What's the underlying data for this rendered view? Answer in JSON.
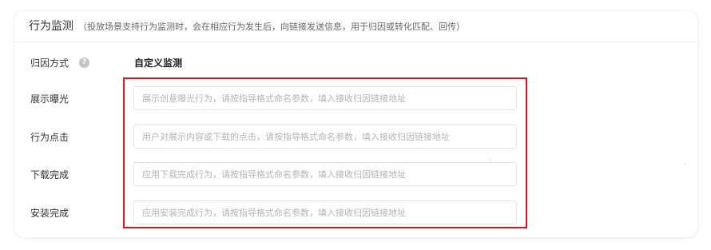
{
  "section": {
    "title": "行为监测",
    "description": "（投放场景支持行为监测时，会在相应行为发生后，向链接发送信息，用于归因或转化匹配、回传）"
  },
  "attribution": {
    "label": "归因方式",
    "help_icon": "help-icon",
    "value": "自定义监测"
  },
  "fields": [
    {
      "label": "展示曝光",
      "placeholder": "展示创意曝光行为，请按指导格式命名参数，填入接收归因链接地址",
      "value": ""
    },
    {
      "label": "行为点击",
      "placeholder": "用户对展示内容或下载的点击，请按指导格式命名参数，填入接收归因链接地址",
      "value": ""
    },
    {
      "label": "下载完成",
      "placeholder": "应用下载完成行为，请按指导格式命名参数，填入接收归因链接地址",
      "value": ""
    },
    {
      "label": "安装完成",
      "placeholder": "应用安装完成行为，请按指导格式命名参数，填入接收归因链接地址",
      "value": ""
    }
  ],
  "colors": {
    "highlight": "#e0141c",
    "text": "#333333",
    "placeholder": "#b4b4b4"
  }
}
